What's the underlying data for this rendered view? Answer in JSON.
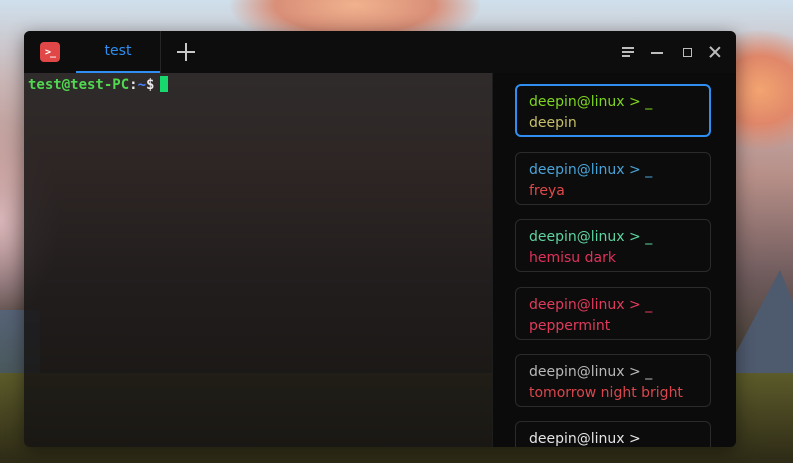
{
  "window": {
    "tab_label": "test",
    "logo_glyph": ">_"
  },
  "terminal": {
    "prompt_user": "test@test-PC",
    "prompt_colon": ":",
    "prompt_path": "~",
    "prompt_dollar": "$",
    "colors": {
      "user": "#50d850",
      "path": "#4a84ff",
      "cursor": "#17d86c"
    }
  },
  "themes": {
    "items": [
      {
        "prompt": "deepin@linux > _",
        "name": "deepin",
        "prompt_color": "#7fd620",
        "name_color": "#c7bf6a",
        "selected": true
      },
      {
        "prompt": "deepin@linux > _",
        "name": "freya",
        "prompt_color": "#4aa3d8",
        "name_color": "#e0494a",
        "selected": false
      },
      {
        "prompt": "deepin@linux > _",
        "name": "hemisu dark",
        "prompt_color": "#5fd3a0",
        "name_color": "#e1315b",
        "selected": false
      },
      {
        "prompt": "deepin@linux > _",
        "name": "peppermint",
        "prompt_color": "#e13b5c",
        "name_color": "#e13b5c",
        "selected": false
      },
      {
        "prompt": "deepin@linux > _",
        "name": "tomorrow night bright",
        "prompt_color": "#b9b9b9",
        "name_color": "#d9464e",
        "selected": false
      },
      {
        "prompt": "deepin@linux >",
        "name": "",
        "prompt_color": "#e4e4e4",
        "name_color": "#e4e4e4",
        "selected": false
      }
    ]
  },
  "accent_color": "#2f8ef0"
}
